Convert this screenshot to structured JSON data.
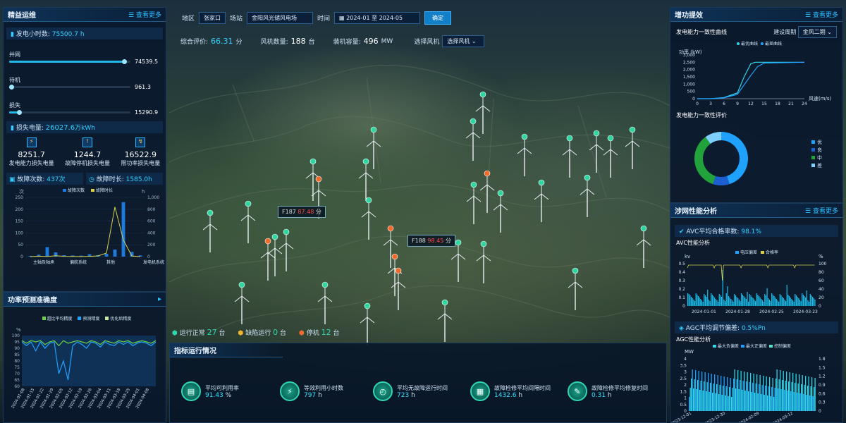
{
  "topbar": {
    "region_label": "地区",
    "region_value": "张家口",
    "station_label": "场站",
    "station_value": "金阳风光储风电场",
    "time_label": "时间",
    "date_from": "2024-01",
    "date_to_word": "至",
    "date_to": "2024-05",
    "confirm": "确定"
  },
  "summary": {
    "score_label": "综合评价:",
    "score_value": "66.31",
    "score_unit": "分",
    "count_label": "风机数量:",
    "count_value": "188",
    "count_unit": "台",
    "capacity_label": "装机容量:",
    "capacity_value": "496",
    "capacity_unit": "MW",
    "select_label": "选择风机",
    "select_value": "选择风机"
  },
  "left": {
    "ops": {
      "title": "精益运维",
      "more": "查看更多",
      "gen_hours_label": "发电小时数:",
      "gen_hours_value": "75500.7",
      "gen_hours_unit": "h",
      "bars": [
        {
          "label": "并网",
          "value": "74539.5",
          "fill": 0.95
        },
        {
          "label": "待机",
          "value": "961.3",
          "fill": 0.02
        },
        {
          "label": "损失",
          "value": "15290.9",
          "fill": 0.08
        }
      ],
      "loss_label": "损失电量:",
      "loss_value": "26027.6",
      "loss_unit": "万kWh",
      "loss_items": [
        {
          "value": "8251.7",
          "label": "发电能力损失电量"
        },
        {
          "value": "1244.7",
          "label": "故障停机损失电量"
        },
        {
          "value": "16522.9",
          "label": "限功率损失电量"
        }
      ],
      "fault_count_label": "故障次数:",
      "fault_count_value": "437",
      "fault_count_unit": "次",
      "fault_time_label": "故障时长:",
      "fault_time_value": "1585.0",
      "fault_time_unit": "h"
    },
    "forecast": {
      "title": "功率预测准确度",
      "legend": [
        "超比平均精度",
        "预测精度",
        "优化后精度"
      ],
      "y_unit": "%"
    }
  },
  "chart_data": [
    {
      "type": "bar",
      "id": "fault",
      "legend": [
        "故障次数",
        "故障时长"
      ],
      "ylabel_left": "次",
      "ylabel_right": "h",
      "yticks_left": [
        "250",
        "200",
        "150",
        "100",
        "50",
        "0"
      ],
      "yticks_right": [
        "1,000",
        "800",
        "600",
        "400",
        "200",
        "0"
      ],
      "categories": [
        "主轴及轴承",
        "偏航系统",
        "其他",
        "发电机系统"
      ],
      "ylim_left": [
        0,
        250
      ],
      "ylim_right": [
        0,
        1000
      ],
      "bars_left": [
        3,
        8,
        40,
        18,
        6,
        5,
        4,
        10,
        6,
        12,
        30,
        230,
        20,
        5
      ],
      "line_right": [
        0,
        8,
        2,
        15,
        5,
        3,
        2,
        5,
        12,
        60,
        840,
        280,
        10,
        0
      ]
    },
    {
      "type": "line",
      "id": "forecast",
      "y_unit": "%",
      "yticks": [
        "100",
        "95",
        "90",
        "85",
        "80",
        "75",
        "70",
        "65",
        "60"
      ],
      "ylim": [
        60,
        100
      ],
      "xticks": [
        "2024-01-08",
        "2024-01-15",
        "2024-01-22",
        "2024-01-29",
        "2024-02-05",
        "2024-02-12",
        "2024-02-19",
        "2024-02-26",
        "2024-03-04",
        "2024-03-11",
        "2024-03-18",
        "2024-03-25",
        "2024-04-01",
        "2024-04-08"
      ],
      "series": [
        {
          "name": "超比平均精度",
          "color": "#6dd04a",
          "values": [
            96,
            94,
            96,
            95,
            96,
            93,
            95,
            96,
            92,
            96,
            94,
            95,
            96,
            95,
            94,
            96,
            95,
            93,
            96,
            95,
            94,
            96,
            95,
            96,
            94,
            95,
            96,
            95,
            94,
            96
          ]
        },
        {
          "name": "预测精度",
          "color": "#1fa2ff",
          "values": [
            95,
            92,
            95,
            88,
            95,
            90,
            94,
            95,
            70,
            80,
            65,
            92,
            95,
            93,
            90,
            95,
            94,
            91,
            95,
            93,
            92,
            95,
            93,
            95,
            92,
            94,
            95,
            94,
            92,
            95
          ]
        }
      ]
    },
    {
      "type": "line",
      "id": "power_curve",
      "title": "发电能力一致性曲线",
      "period_label": "建设周期",
      "period_value": "金风二期",
      "legend": [
        "最优曲线",
        "最差曲线"
      ],
      "ylabel": "功率 (kW)",
      "xlabel": "风速(m/s)",
      "yticks": [
        "3,000",
        "2,500",
        "2,000",
        "1,500",
        "1,000",
        "500",
        "0"
      ],
      "xticks": [
        "0",
        "3",
        "6",
        "9",
        "12",
        "15",
        "18",
        "21",
        "24"
      ],
      "best": [
        [
          0,
          0
        ],
        [
          3,
          0
        ],
        [
          6,
          80
        ],
        [
          9,
          400
        ],
        [
          10.5,
          1500
        ],
        [
          12,
          2400
        ],
        [
          13,
          2500
        ],
        [
          24,
          2500
        ]
      ],
      "worst": [
        [
          0,
          0
        ],
        [
          3,
          0
        ],
        [
          6,
          60
        ],
        [
          9,
          300
        ],
        [
          12,
          1600
        ],
        [
          13.5,
          2200
        ],
        [
          15,
          2450
        ],
        [
          24,
          2500
        ]
      ]
    },
    {
      "type": "pie",
      "id": "consistency",
      "title": "发电能力一致性评价",
      "legend": [
        "优",
        "良",
        "中",
        "差"
      ],
      "colors": [
        "#1fa2ff",
        "#1b5fd0",
        "#22a23a",
        "#7fd0ff"
      ],
      "values": [
        45,
        10,
        35,
        10
      ]
    },
    {
      "type": "area",
      "id": "avc",
      "title": "AVC性能分析",
      "legend": [
        "电压偏差",
        "合格率"
      ],
      "ylabel_left": "kv",
      "ylabel_right": "%",
      "yticks_left": [
        "0.5",
        "0.4",
        "0.3",
        "0.2",
        "0.1",
        "0"
      ],
      "yticks_right": [
        "100",
        "80",
        "60",
        "40",
        "20",
        "0"
      ],
      "xticks": [
        "2024-01-01",
        "2024-01-28",
        "2024-02-25",
        "2024-03-23"
      ]
    },
    {
      "type": "area",
      "id": "agc",
      "title": "AGC性能分析",
      "legend": [
        "最大负偏差",
        "最大正偏差",
        "控制偏差"
      ],
      "ylabel_left": "MW",
      "yticks_left": [
        "4",
        "3.5",
        "3",
        "2.5",
        "2",
        "1.5",
        "1",
        "0.5",
        "0"
      ],
      "yticks_right": [
        "1.8",
        "1.5",
        "1.2",
        "0.9",
        "0.6",
        "0.3",
        "0"
      ],
      "xticks": [
        "2023-12-01",
        "2023-12-30",
        "2024-02-09",
        "2024-03-12"
      ]
    }
  ],
  "right": {
    "efficiency": {
      "title": "增功提效",
      "more": "查看更多"
    },
    "grid": {
      "title": "涉网性能分析",
      "more": "查看更多",
      "avc_label": "AVC平均合格率数:",
      "avc_value": "98.1",
      "avc_unit": "%",
      "agc_label": "AGC平均调节偏差:",
      "agc_value": "0.5",
      "agc_unit": "%Pn"
    }
  },
  "bottom": {
    "title": "指标运行情况",
    "status": [
      {
        "label": "运行正常",
        "value": "27",
        "unit": "台"
      },
      {
        "label": "缺陷运行",
        "value": "0",
        "unit": "台"
      },
      {
        "label": "停机",
        "value": "12",
        "unit": "台"
      }
    ],
    "kpis": [
      {
        "label": "平均可利用率",
        "value": "91.43",
        "unit": "%"
      },
      {
        "label": "等效利用小时数",
        "value": "797",
        "unit": "h"
      },
      {
        "label": "平均无故障运行时间",
        "value": "723",
        "unit": "h"
      },
      {
        "label": "故障检修平均间隔时间",
        "value": "1432.6",
        "unit": "h"
      },
      {
        "label": "故障检修平均修复时间",
        "value": "0.31",
        "unit": "h"
      }
    ]
  },
  "map": {
    "labels": [
      {
        "name": "F187",
        "score": "87.48",
        "unit": "分"
      },
      {
        "name": "F188",
        "score": "98.45",
        "unit": "分"
      }
    ]
  }
}
